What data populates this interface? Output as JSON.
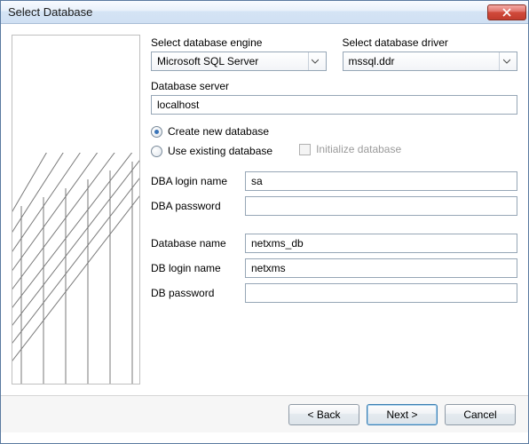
{
  "window": {
    "title": "Select Database"
  },
  "form": {
    "engine_label": "Select database engine",
    "engine_value": "Microsoft SQL Server",
    "driver_label": "Select database driver",
    "driver_value": "mssql.ddr",
    "server_label": "Database server",
    "server_value": "localhost",
    "radio_create": "Create new database",
    "radio_existing": "Use existing database",
    "check_init": "Initialize database",
    "dba_login_label": "DBA login name",
    "dba_login_value": "sa",
    "dba_password_label": "DBA password",
    "dba_password_value": "",
    "db_name_label": "Database name",
    "db_name_value": "netxms_db",
    "db_login_label": "DB login name",
    "db_login_value": "netxms",
    "db_password_label": "DB password",
    "db_password_value": ""
  },
  "buttons": {
    "back": "< Back",
    "next": "Next >",
    "cancel": "Cancel"
  }
}
